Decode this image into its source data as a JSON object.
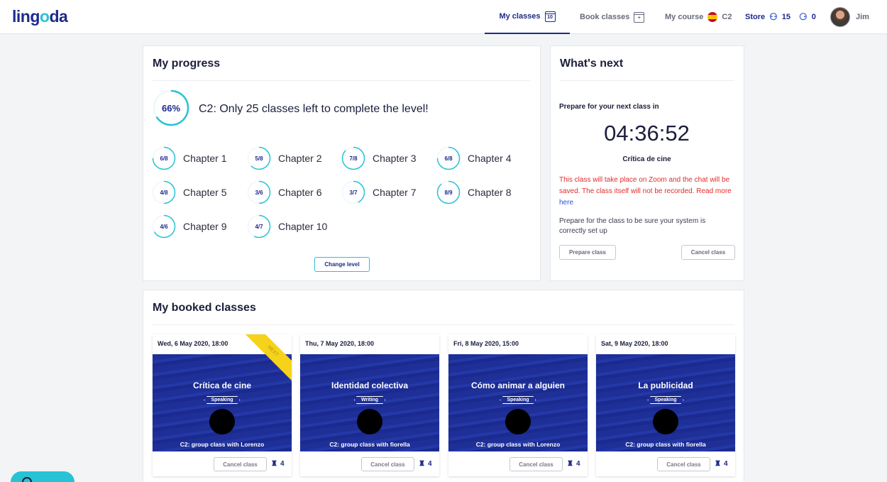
{
  "header": {
    "logo": {
      "part1": "ling",
      "part2": "o",
      "part3": "da"
    },
    "nav": {
      "my_classes": "My classes",
      "my_classes_icon_day": "10",
      "book_classes": "Book classes",
      "my_course": "My course",
      "course_level": "C2",
      "store": "Store",
      "group_credits": "15",
      "private_credits": "0",
      "user_name": "Jim"
    }
  },
  "progress": {
    "title": "My progress",
    "percent": "66%",
    "percent_value": 0.66,
    "message": "C2: Only 25 classes left to complete the level!",
    "chapters": [
      {
        "label": "6/8",
        "name": "Chapter 1",
        "fraction": 0.75
      },
      {
        "label": "5/8",
        "name": "Chapter 2",
        "fraction": 0.625
      },
      {
        "label": "7/8",
        "name": "Chapter 3",
        "fraction": 0.875
      },
      {
        "label": "6/8",
        "name": "Chapter 4",
        "fraction": 0.75
      },
      {
        "label": "4/8",
        "name": "Chapter 5",
        "fraction": 0.5
      },
      {
        "label": "3/6",
        "name": "Chapter 6",
        "fraction": 0.5
      },
      {
        "label": "3/7",
        "name": "Chapter 7",
        "fraction": 0.4286
      },
      {
        "label": "8/9",
        "name": "Chapter 8",
        "fraction": 0.8889
      },
      {
        "label": "4/6",
        "name": "Chapter 9",
        "fraction": 0.6667
      },
      {
        "label": "4/7",
        "name": "Chapter 10",
        "fraction": 0.5714
      }
    ],
    "change_level": "Change level"
  },
  "whats_next": {
    "title": "What's next",
    "prepare_label": "Prepare for your next class in",
    "countdown": "04:36:52",
    "class_name": "Crítica de cine",
    "zoom_note": "This class will take place on Zoom and the chat will be saved. The class itself will not be recorded. Read more",
    "zoom_link": "here",
    "prepare_note": "Prepare for the class to be sure your system is correctly set up",
    "prepare_button": "Prepare class",
    "cancel_button": "Cancel class"
  },
  "booked": {
    "title": "My booked classes",
    "next_ribbon": "NEXT",
    "cards": [
      {
        "date": "Wed, 6 May 2020, 18:00",
        "title": "Crítica de cine",
        "type": "Speaking",
        "teacher": "C2: group class with Lorenzo",
        "cancel": "Cancel class",
        "seats": "4"
      },
      {
        "date": "Thu, 7 May 2020, 18:00",
        "title": "Identidad colectiva",
        "type": "Writing",
        "teacher": "C2: group class with fiorella",
        "cancel": "Cancel class",
        "seats": "4"
      },
      {
        "date": "Fri, 8 May 2020, 15:00",
        "title": "Cómo animar a alguien",
        "type": "Speaking",
        "teacher": "C2: group class with Lorenzo",
        "cancel": "Cancel class",
        "seats": "4"
      },
      {
        "date": "Sat, 9 May 2020, 18:00",
        "title": "La publicidad",
        "type": "Speaking",
        "teacher": "C2: group class with fiorella",
        "cancel": "Cancel class",
        "seats": "4"
      }
    ]
  },
  "colors": {
    "brand": "#1d2a8c",
    "accent": "#27c3d4",
    "warning": "#e32b2b",
    "ribbon": "#f6d21b"
  }
}
